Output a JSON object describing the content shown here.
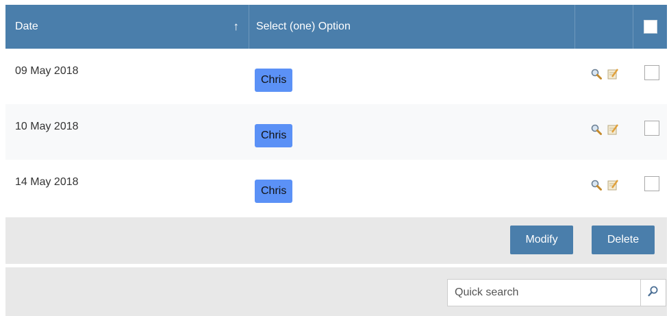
{
  "table": {
    "columns": {
      "date": "Date",
      "sort_indicator": "↑",
      "option": "Select (one) Option"
    },
    "rows": [
      {
        "date": "09 May 2018",
        "option": "Chris"
      },
      {
        "date": "10 May 2018",
        "option": "Chris"
      },
      {
        "date": "14 May 2018",
        "option": "Chris"
      }
    ]
  },
  "actions": {
    "modify_label": "Modify",
    "delete_label": "Delete"
  },
  "search": {
    "placeholder": "Quick search"
  },
  "icons": {
    "view": "search-icon",
    "edit": "edit-icon",
    "search_button": "search-icon"
  },
  "colors": {
    "header_bg": "#4a7eab",
    "chip_bg": "#5b91f6",
    "button_bg": "#4a7eab",
    "bar_bg": "#e8e8e8"
  }
}
